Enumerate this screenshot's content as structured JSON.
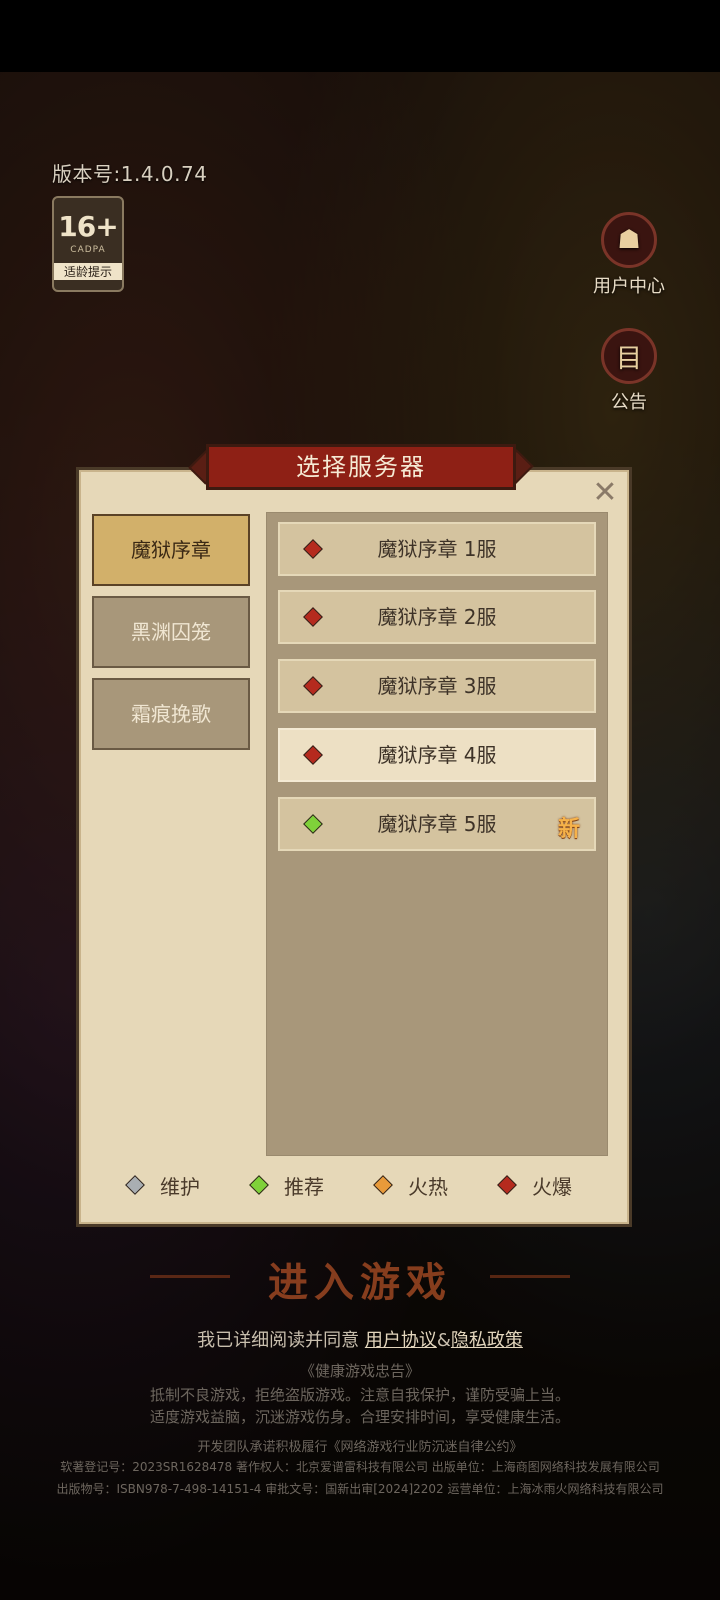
{
  "header": {
    "version": "版本号:1.4.0.74",
    "age_badge": {
      "rating": "16+",
      "org": "CADPA",
      "tip": "适龄提示"
    },
    "side_buttons": [
      {
        "label": "用户中心",
        "icon": "user-center-icon",
        "glyph": "☗"
      },
      {
        "label": "公告",
        "icon": "notice-icon",
        "glyph": "目"
      }
    ]
  },
  "dialog": {
    "title": "选择服务器",
    "close_glyph": "✕",
    "categories": [
      {
        "label": "魔狱序章",
        "active": true
      },
      {
        "label": "黑渊囚笼",
        "active": false
      },
      {
        "label": "霜痕挽歌",
        "active": false
      }
    ],
    "servers": [
      {
        "name": "魔狱序章 1服",
        "status_color": "#b52a1e",
        "selected": false,
        "new": ""
      },
      {
        "name": "魔狱序章 2服",
        "status_color": "#b52a1e",
        "selected": false,
        "new": ""
      },
      {
        "name": "魔狱序章 3服",
        "status_color": "#b52a1e",
        "selected": false,
        "new": ""
      },
      {
        "name": "魔狱序章 4服",
        "status_color": "#b52a1e",
        "selected": true,
        "new": ""
      },
      {
        "name": "魔狱序章 5服",
        "status_color": "#7fd13a",
        "selected": false,
        "new": "新"
      }
    ],
    "legend": [
      {
        "label": "维护",
        "color": "#a9aeb2"
      },
      {
        "label": "推荐",
        "color": "#7fd13a"
      },
      {
        "label": "火热",
        "color": "#e89a3a"
      },
      {
        "label": "火爆",
        "color": "#b52a1e"
      }
    ]
  },
  "footer": {
    "enter_button": "进入游戏",
    "agree_prefix": "我已详细阅读并同意",
    "user_agreement": "用户协议",
    "amp": "&",
    "privacy_policy": "隐私政策",
    "health_title": "《健康游戏忠告》",
    "health_line1": "抵制不良游戏，拒绝盗版游戏。注意自我保护，谨防受骗上当。",
    "health_line2": "适度游戏益脑，沉迷游戏伤身。合理安排时间，享受健康生活。",
    "pledge": "开发团队承诺积极履行《网络游戏行业防沉迷自律公约》",
    "legal_line1": "软著登记号：2023SR1628478 著作权人：北京爱谱雷科技有限公司 出版单位：上海商图网络科技发展有限公司",
    "legal_line2": "出版物号：ISBN978-7-498-14151-4 审批文号：国新出审[2024]2202 运营单位：上海冰雨火网络科技有限公司"
  }
}
